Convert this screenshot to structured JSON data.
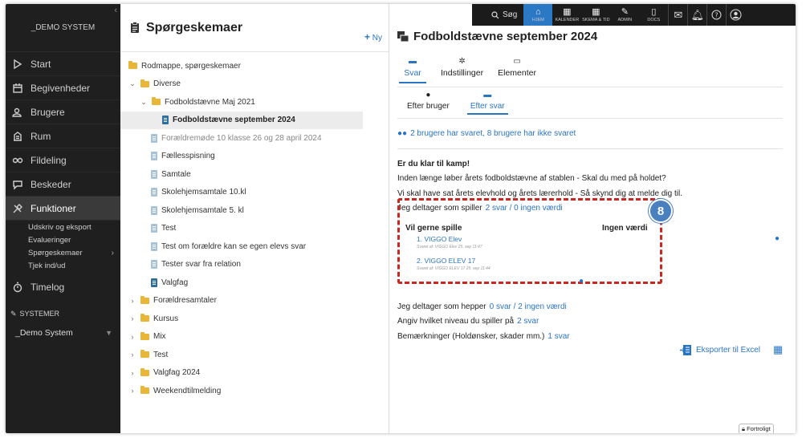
{
  "sidebar": {
    "collapse_glyph": "‹",
    "logo": "_DEMO SYSTEM",
    "items": [
      {
        "label": "Start",
        "icon": "play-icon"
      },
      {
        "label": "Begivenheder",
        "icon": "calendar-icon"
      },
      {
        "label": "Brugere",
        "icon": "users-icon"
      },
      {
        "label": "Rum",
        "icon": "building-icon"
      },
      {
        "label": "Fildeling",
        "icon": "share-icon"
      },
      {
        "label": "Beskeder",
        "icon": "chat-icon"
      },
      {
        "label": "Funktioner",
        "icon": "tools-icon",
        "active": true
      }
    ],
    "sub_items": [
      "Udskriv og eksport",
      "Evalueringer",
      "Spørgeskemaer",
      "Tjek ind/ud"
    ],
    "timelog": "Timelog",
    "systems_heading": "SYSTEMER",
    "system_name": "_Demo System"
  },
  "middle": {
    "title": "Spørgeskemaer",
    "new_label": "Ny",
    "tree": [
      {
        "label": "Rodmappe, spørgeskemaer",
        "type": "folder",
        "level": 0,
        "chev": ""
      },
      {
        "label": "Diverse",
        "type": "folder",
        "level": 0,
        "chev": "down"
      },
      {
        "label": "Fodboldstævne Maj 2021",
        "type": "folder",
        "level": 1,
        "chev": "down"
      },
      {
        "label": "Fodboldstævne september 2024",
        "type": "doc",
        "level": 2,
        "selected": true
      },
      {
        "label": "Forældremøde 10 klasse 26 og 28 april 2024",
        "type": "doc-light",
        "level": 1,
        "muted": true
      },
      {
        "label": "Fællesspisning",
        "type": "doc-light",
        "level": 1
      },
      {
        "label": "Samtale",
        "type": "doc-light",
        "level": 1
      },
      {
        "label": "Skolehjemsamtale 10.kl",
        "type": "doc-light",
        "level": 1
      },
      {
        "label": "Skolehjemsamtale 5. kl",
        "type": "doc-light",
        "level": 1
      },
      {
        "label": "Test",
        "type": "doc-light",
        "level": 1
      },
      {
        "label": "Test om forældre kan se egen elevs svar",
        "type": "doc-light",
        "level": 1
      },
      {
        "label": "Tester svar fra relation",
        "type": "doc-light",
        "level": 1
      },
      {
        "label": "Valgfag",
        "type": "doc",
        "level": 1
      },
      {
        "label": "Forældresamtaler",
        "type": "folder",
        "level": 0,
        "chev": "right"
      },
      {
        "label": "Kursus",
        "type": "folder",
        "level": 0,
        "chev": "right"
      },
      {
        "label": "Mix",
        "type": "folder",
        "level": 0,
        "chev": "right"
      },
      {
        "label": "Test",
        "type": "folder",
        "level": 0,
        "chev": "right"
      },
      {
        "label": "Valgfag 2024",
        "type": "folder",
        "level": 0,
        "chev": "right"
      },
      {
        "label": "Weekendtilmelding",
        "type": "folder",
        "level": 0,
        "chev": "right"
      }
    ]
  },
  "topbar": {
    "search": "Søg",
    "buttons": [
      {
        "label": "HJEM",
        "glyph": "⌂",
        "active": true
      },
      {
        "label": "KALENDER",
        "glyph": "▦"
      },
      {
        "label": "SKEMA & TID",
        "glyph": "▦"
      },
      {
        "label": "ADMIN",
        "glyph": "✎"
      },
      {
        "label": "DOCS",
        "glyph": "▯"
      }
    ]
  },
  "right": {
    "title": "Fodboldstævne september 2024",
    "tabs": [
      {
        "label": "Svar",
        "active": true
      },
      {
        "label": "Indstillinger"
      },
      {
        "label": "Elementer"
      }
    ],
    "subtabs": [
      {
        "label": "Efter bruger"
      },
      {
        "label": "Efter svar",
        "active": true
      }
    ],
    "summary": "2 brugere har svaret, 8 brugere har ikke svaret",
    "intro_title": "Er du klar til kamp!",
    "intro_line1": "Inden længe løber årets fodboldstævne af stablen - Skal du med på holdet?",
    "intro_line2": "Vi skal have sat årets elevhold og årets lærerhold - Så skynd dig at melde dig til.",
    "q1": {
      "text": "Jeg deltager som spiller",
      "link": "2 svar / 0 ingen værdi"
    },
    "badge": "8",
    "answers_heading": "Vil gerne spille",
    "no_value_heading": "Ingen værdi",
    "answers": [
      {
        "name": "1. VIGGO Elev",
        "meta": "Svaret af: VIGGO Elev 25. sep 11:47"
      },
      {
        "name": "2. VIGGO ELEV 17",
        "meta": "Svaret af: VIGGO ELEV 17 25. sep 11:44"
      }
    ],
    "q2": {
      "text": "Jeg deltager som hepper",
      "link": "0 svar / 2 ingen værdi"
    },
    "q3": {
      "text": "Angiv hvilket niveau du spiller på",
      "link": "2 svar"
    },
    "q4": {
      "text": "Bemærkninger (Holdønsker, skader mm.)",
      "link": "1 svar"
    },
    "export_label": "Eksporter til Excel",
    "confidential": "Fortroligt"
  },
  "colors": {
    "accent": "#2a74c4",
    "highlight": "#c8281e",
    "badge": "#4a7fc0",
    "sidebar": "#1f1f1f",
    "folder": "#e8b73a"
  }
}
